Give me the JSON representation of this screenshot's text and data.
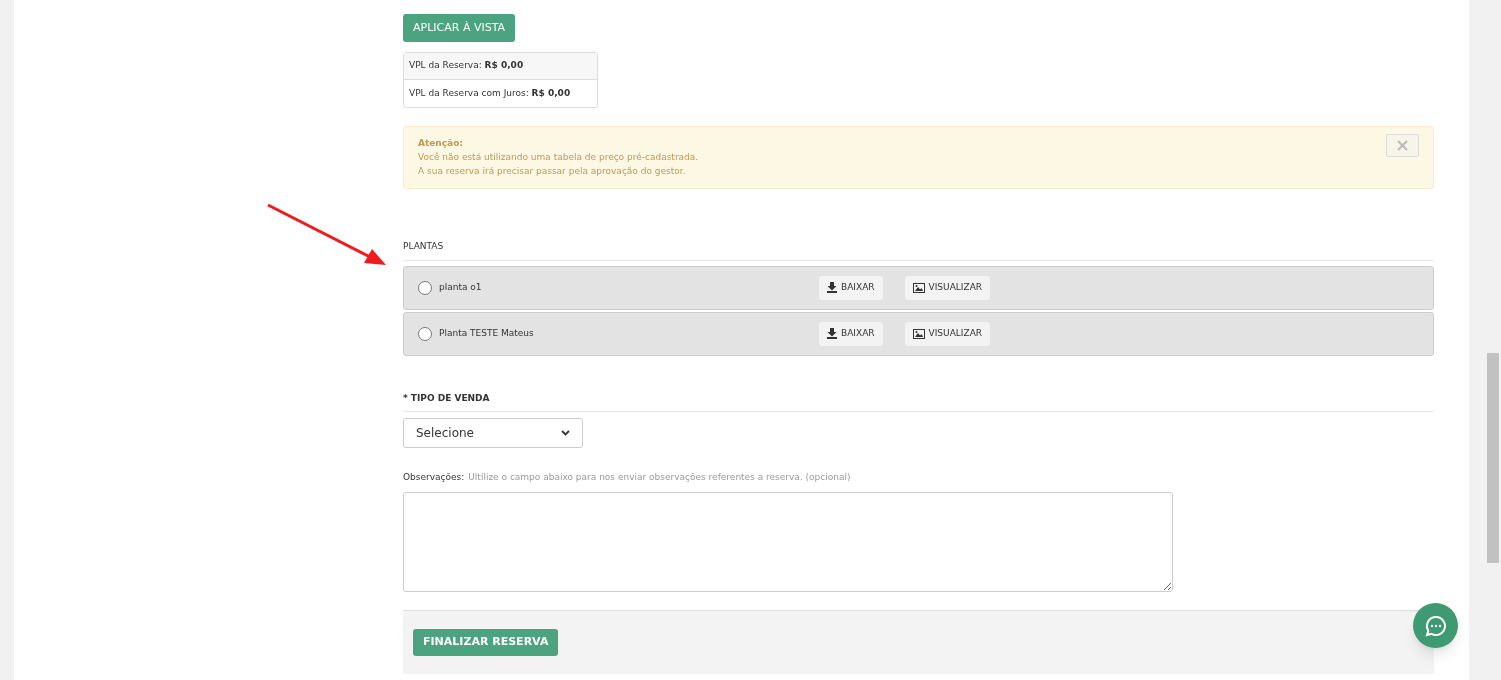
{
  "apply_button": "APLICAR À VISTA",
  "vpl": [
    "VPL da Reserva: **R$ 0,00**",
    "VPL da Reserva com Juros: **R$ 0,00**"
  ],
  "alert": {
    "title": "Atenção:",
    "lines": [
      "Você não está utilizando uma tabela de preço pré-cadastrada.",
      "A sua reserva irá precisar passar pela aprovação do gestor."
    ]
  },
  "plantas": {
    "heading": "PLANTAS",
    "items": [
      {
        "name": "planta o1",
        "selected": false,
        "download": "BAIXAR",
        "view": "VISUALIZAR"
      },
      {
        "name": "Planta TESTE Mateus",
        "selected": false,
        "download": "BAIXAR",
        "view": "VISUALIZAR"
      }
    ]
  },
  "tipo_venda": {
    "heading": "* TIPO DE VENDA",
    "value": "Selecione"
  },
  "observacoes": {
    "label": "Observações:",
    "hint": "Ultilize o campo abaixo para nos enviar observações referentes a reserva. (opcional)"
  },
  "submit_button": "FINALIZAR RESERVA"
}
